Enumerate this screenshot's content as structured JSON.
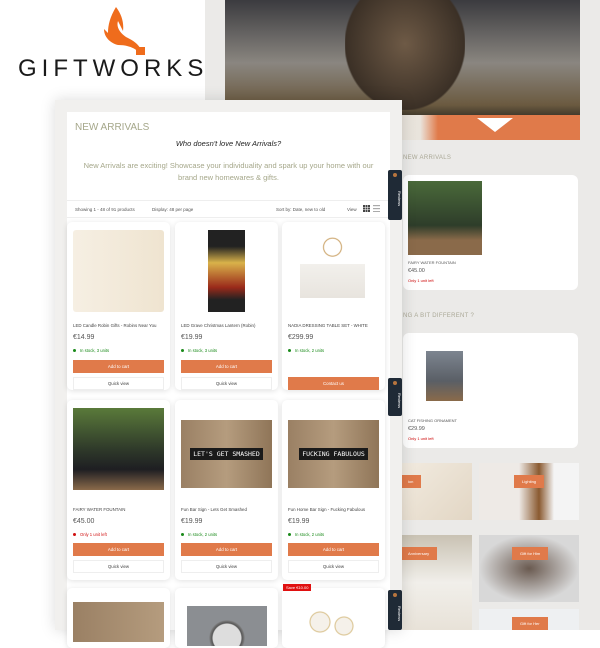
{
  "brand": {
    "name": "GIFTWORKS",
    "accent": "#e07a4a"
  },
  "page": {
    "title": "NEW ARRIVALS",
    "question": "Who doesn't love New Arrivals?",
    "description": "New Arrivals are exciting! Showcase your individuality and spark up your home with our brand new homewares & gifts."
  },
  "toolbar": {
    "showing": "Showing 1 - 48 of 91 products",
    "display": "Display: 48 per page",
    "sort": "Sort by: Date, new to old",
    "view": "View"
  },
  "reviews_tab": "Reviews",
  "products": [
    {
      "name": "LED Candle Robin Gifts - Robins Near You",
      "price": "€14.99",
      "stock": "In stock, 3 units",
      "stock_status": "in",
      "cta": "Add to cart",
      "quick": "Quick view"
    },
    {
      "name": "LED Grave Christmas Lantern (Robin)",
      "price": "€19.99",
      "stock": "In stock, 3 units",
      "stock_status": "in",
      "cta": "Add to cart",
      "quick": "Quick view"
    },
    {
      "name": "NADIA DRESSING TABLE SET - WHITE",
      "price": "€299.99",
      "stock": "In stock, 2 units",
      "stock_status": "in",
      "cta": "Contact us"
    },
    {
      "name": "FAIRY WATER FOUNTAIN",
      "price": "€45.00",
      "stock": "Only 1 unit left",
      "stock_status": "low",
      "cta": "Add to cart",
      "quick": "Quick view"
    },
    {
      "name": "Fun Bar Sign - Lets Get Smashed",
      "price": "€19.99",
      "stock": "In stock, 2 units",
      "stock_status": "in",
      "cta": "Add to cart",
      "quick": "Quick view",
      "sign": "LET'S GET SMASHED"
    },
    {
      "name": "Fun Home Bar Sign - Fucking Fabulous",
      "price": "€19.99",
      "stock": "In stock, 2 units",
      "stock_status": "in",
      "cta": "Add to cart",
      "quick": "Quick view",
      "sign": "FUCKING FABULOUS"
    }
  ],
  "row3_badge": "Save €10.00",
  "right": {
    "section1": "NEW ARRIVALS",
    "product1": {
      "name": "FAIRY WATER FOUNTAIN",
      "price": "€45.00",
      "stock": "Only 1 unit left"
    },
    "section2": "NG A BIT DIFFERENT ?",
    "product2": {
      "name": "CAT FISHING ORNAMENT",
      "price": "€29.99",
      "stock": "Only 1 unit left"
    },
    "categories": [
      "ion",
      "Lighting",
      "Anniversary",
      "Gift for Him",
      "Gift for Her"
    ]
  }
}
